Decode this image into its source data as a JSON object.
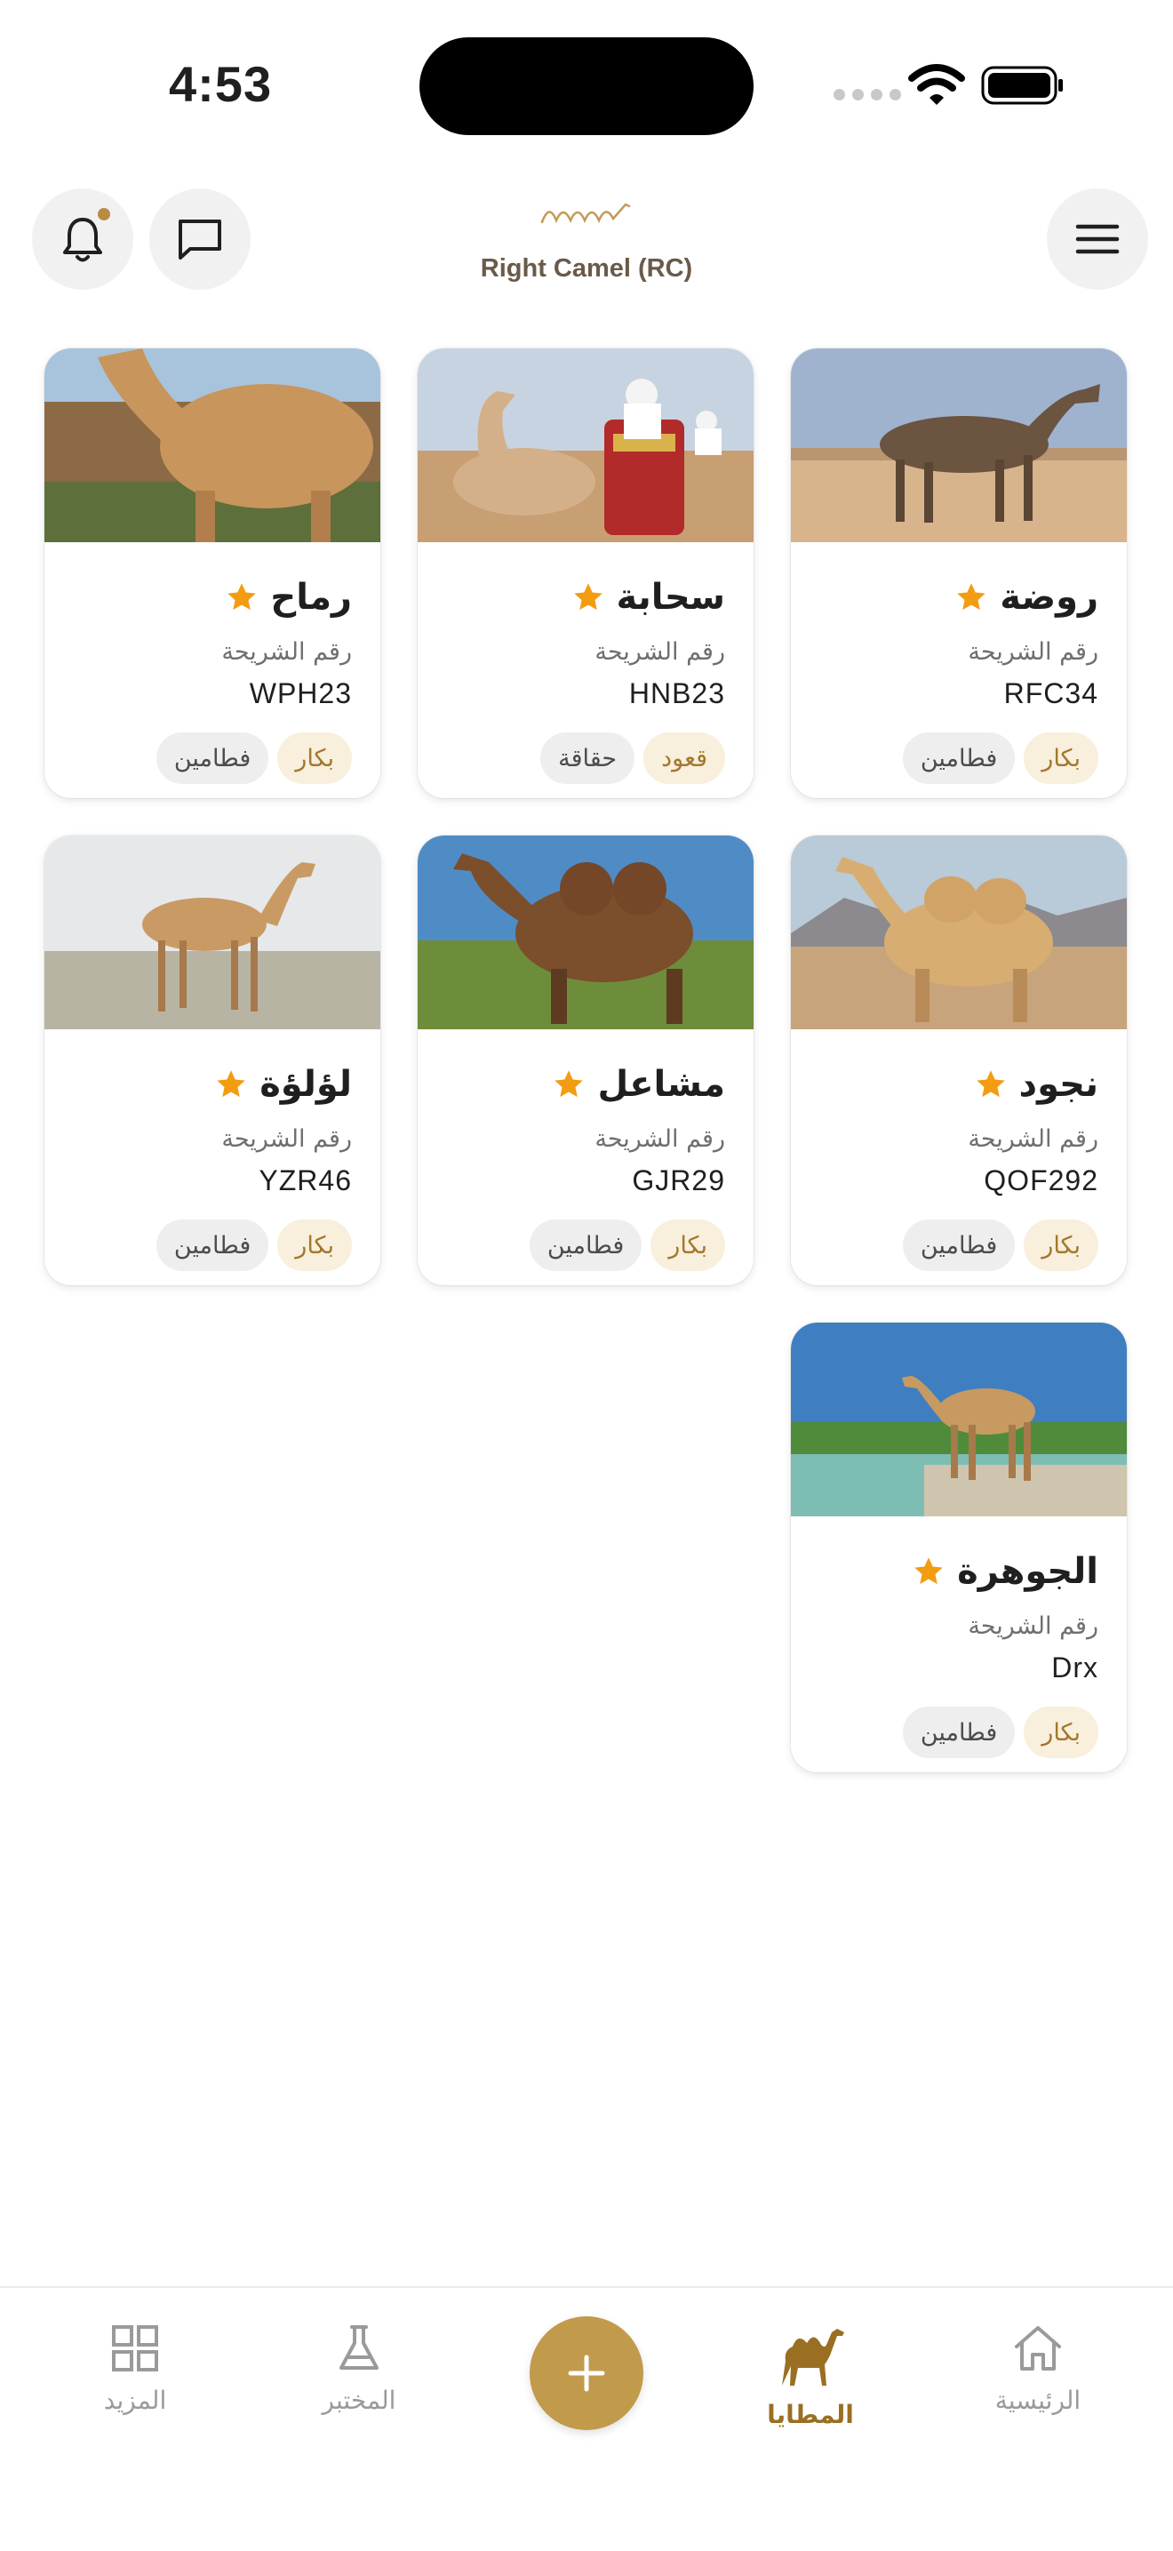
{
  "status_bar": {
    "time": "4:53"
  },
  "header": {
    "brand_name": "Right Camel (RC)"
  },
  "chip_label": "رقم الشريحة",
  "camels": [
    {
      "name": "روضة",
      "chip": "RFC34",
      "tags": [
        "بكار",
        "فطامين"
      ]
    },
    {
      "name": "سحابة",
      "chip": "HNB23",
      "tags": [
        "قعود",
        "حقاقة"
      ]
    },
    {
      "name": "رماح",
      "chip": "WPH23",
      "tags": [
        "بكار",
        "فطامين"
      ]
    },
    {
      "name": "نجود",
      "chip": "QOF292",
      "tags": [
        "بكار",
        "فطامين"
      ]
    },
    {
      "name": "مشاعل",
      "chip": "GJR29",
      "tags": [
        "بكار",
        "فطامين"
      ]
    },
    {
      "name": "لؤلؤة",
      "chip": "YZR46",
      "tags": [
        "بكار",
        "فطامين"
      ]
    },
    {
      "name": "الجوهرة",
      "chip": "Drx",
      "tags": [
        "بكار",
        "فطامين"
      ]
    }
  ],
  "nav": {
    "home": "الرئيسية",
    "camels": "المطايا",
    "lab": "المختبر",
    "more": "المزيد"
  },
  "colors": {
    "accent": "#c19a4c",
    "accent_dark": "#9a6f22",
    "star": "#f39c12"
  },
  "icons": [
    "bell-icon",
    "chat-icon",
    "menu-icon",
    "star-icon",
    "home-icon",
    "camel-icon",
    "plus-icon",
    "flask-icon",
    "grid-icon"
  ]
}
